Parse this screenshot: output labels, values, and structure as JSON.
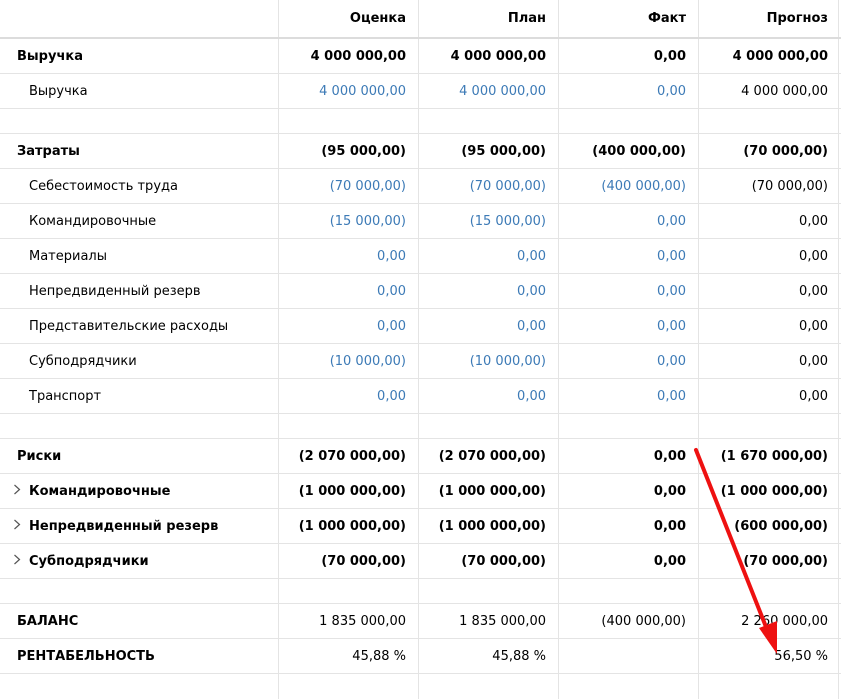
{
  "header": {
    "col0": "",
    "col1": "Оценка",
    "col2": "План",
    "col3": "Факт",
    "col4": "Прогноз"
  },
  "rows": [
    {
      "label": "Выручка",
      "v": [
        "4 000 000,00",
        "4 000 000,00",
        "0,00",
        "4 000 000,00"
      ]
    },
    {
      "label": "Выручка",
      "v": [
        "4 000 000,00",
        "4 000 000,00",
        "0,00",
        "4 000 000,00"
      ]
    },
    {
      "label": "Затраты",
      "v": [
        "(95 000,00)",
        "(95 000,00)",
        "(400 000,00)",
        "(70 000,00)"
      ]
    },
    {
      "label": "Себестоимость труда",
      "v": [
        "(70 000,00)",
        "(70 000,00)",
        "(400 000,00)",
        "(70 000,00)"
      ]
    },
    {
      "label": "Командировочные",
      "v": [
        "(15 000,00)",
        "(15 000,00)",
        "0,00",
        "0,00"
      ]
    },
    {
      "label": "Материалы",
      "v": [
        "0,00",
        "0,00",
        "0,00",
        "0,00"
      ]
    },
    {
      "label": "Непредвиденный резерв",
      "v": [
        "0,00",
        "0,00",
        "0,00",
        "0,00"
      ]
    },
    {
      "label": "Представительские расходы",
      "v": [
        "0,00",
        "0,00",
        "0,00",
        "0,00"
      ]
    },
    {
      "label": "Субподрядчики",
      "v": [
        "(10 000,00)",
        "(10 000,00)",
        "0,00",
        "0,00"
      ]
    },
    {
      "label": "Транспорт",
      "v": [
        "0,00",
        "0,00",
        "0,00",
        "0,00"
      ]
    },
    {
      "label": "Риски",
      "v": [
        "(2 070 000,00)",
        "(2 070 000,00)",
        "0,00",
        "(1 670 000,00)"
      ]
    },
    {
      "label": "Командировочные",
      "v": [
        "(1 000 000,00)",
        "(1 000 000,00)",
        "0,00",
        "(1 000 000,00)"
      ]
    },
    {
      "label": "Непредвиденный резерв",
      "v": [
        "(1 000 000,00)",
        "(1 000 000,00)",
        "0,00",
        "(600 000,00)"
      ]
    },
    {
      "label": "Субподрядчики",
      "v": [
        "(70 000,00)",
        "(70 000,00)",
        "0,00",
        "(70 000,00)"
      ]
    },
    {
      "label": "БАЛАНС",
      "v": [
        "1 835 000,00",
        "1 835 000,00",
        "(400 000,00)",
        "2 260 000,00"
      ]
    },
    {
      "label": "РЕНТАБЕЛЬНОСТЬ",
      "v": [
        "45,88 %",
        "45,88 %",
        "",
        "56,50 %"
      ]
    }
  ],
  "colors": {
    "link": "#3c7ab6",
    "arrow": "#ee1111",
    "grid": "#e4e4e4"
  },
  "icons": {
    "expand": "chevron-right-icon"
  }
}
